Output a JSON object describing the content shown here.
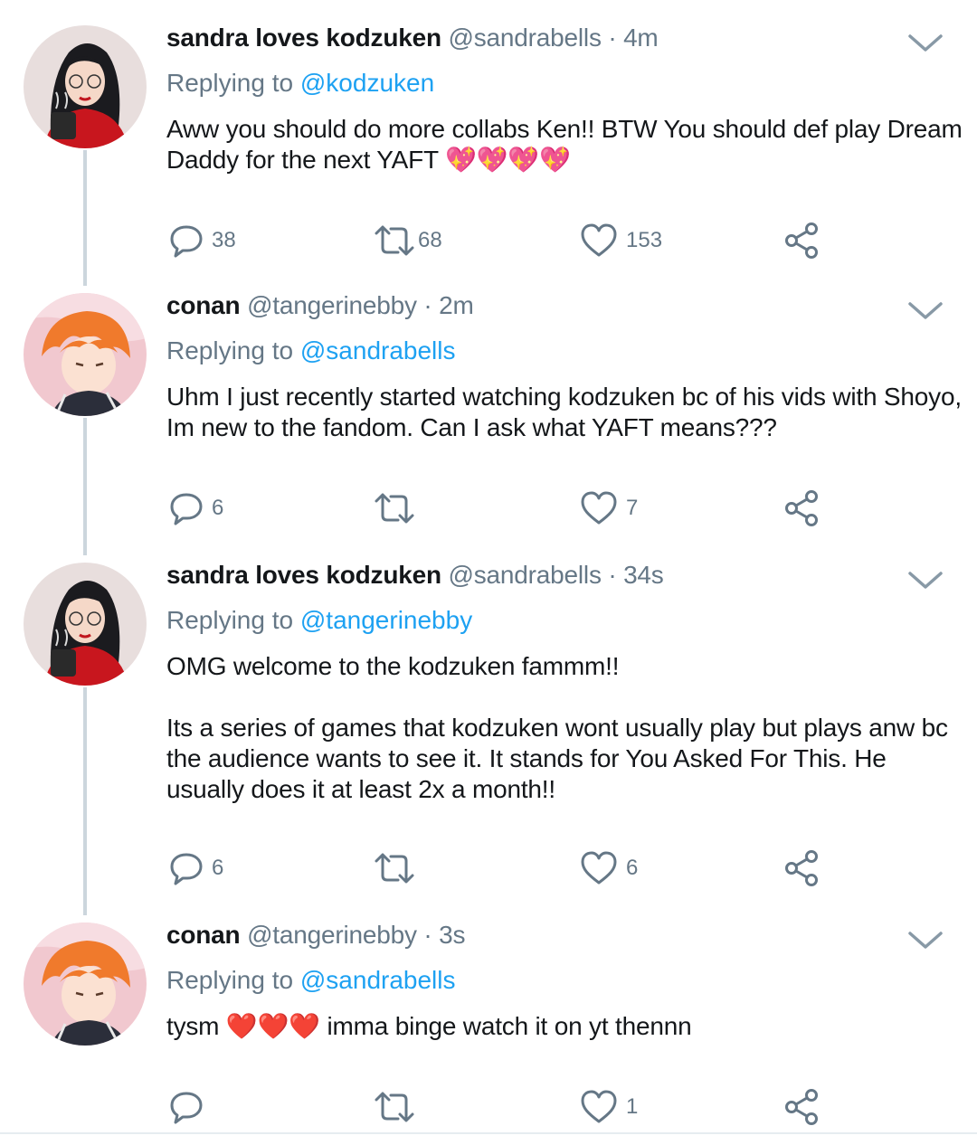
{
  "tweets": [
    {
      "name": "sandra loves kodzuken",
      "handle": "@sandrabells",
      "dot": "·",
      "time": "4m",
      "replying_prefix": "Replying to",
      "replying_to": "@kodzuken",
      "text": "Aww you should do more collabs Ken!! BTW You should def play Dream Daddy for the next YAFT",
      "text_emoji": "💖💖💖💖",
      "replies": "38",
      "retweets": "68",
      "likes": "153"
    },
    {
      "name": "conan",
      "handle": "@tangerinebby",
      "dot": "·",
      "time": "2m",
      "replying_prefix": "Replying to",
      "replying_to": "@sandrabells",
      "text": "Uhm I just recently started watching kodzuken bc of his vids with Shoyo, Im new to the fandom. Can I ask what YAFT means???",
      "replies": "6",
      "retweets": "",
      "likes": "7"
    },
    {
      "name": "sandra loves kodzuken",
      "handle": "@sandrabells",
      "dot": "·",
      "time": "34s",
      "replying_prefix": "Replying to",
      "replying_to": "@tangerinebby",
      "text": "OMG welcome to the kodzuken fammm!!\n\nIts a series of games that kodzuken wont usually play but plays anw bc the audience wants to see it. It stands for You Asked For This. He usually does it at least 2x a month!!",
      "replies": "6",
      "retweets": "",
      "likes": "6"
    },
    {
      "name": "conan",
      "handle": "@tangerinebby",
      "dot": "·",
      "time": "3s",
      "replying_prefix": "Replying to",
      "replying_to": "@sandrabells",
      "text_before": "tysm",
      "text_emoji": "❤️❤️❤️",
      "text_after": "imma binge watch it on yt thennn",
      "replies": "",
      "retweets": "",
      "likes": "1"
    }
  ],
  "icons": {
    "reply": "reply-icon",
    "retweet": "retweet-icon",
    "like": "heart-icon",
    "share": "share-icon",
    "menu": "chevron-down-icon"
  },
  "colors": {
    "link": "#1da1f2",
    "muted": "#657786",
    "text": "#14171a"
  }
}
